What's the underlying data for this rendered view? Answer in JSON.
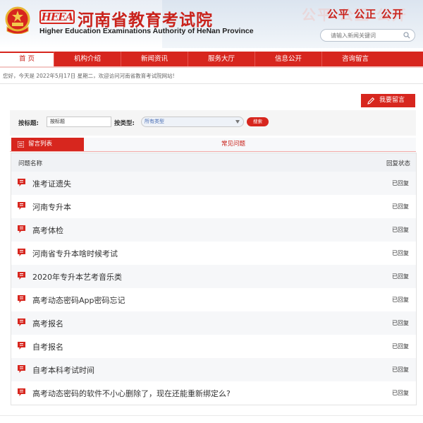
{
  "header": {
    "logo_abbr": "HEEA",
    "title_cn": "河南省教育考试院",
    "title_en": "Higher Education Examinations Authority of HeNan Province",
    "slogan": "公平 公正 公开",
    "search_placeholder": "请输入新闻关键词",
    "colors": {
      "brand_red": "#d7261e"
    }
  },
  "nav": {
    "items": [
      {
        "label": "首 页",
        "active": true
      },
      {
        "label": "机构介绍"
      },
      {
        "label": "新闻资讯"
      },
      {
        "label": "服务大厅"
      },
      {
        "label": "信息公开"
      },
      {
        "label": "咨询留言"
      }
    ]
  },
  "welcome": "您好，今天是 2022年5月17日 星期二，欢迎访问河南省教育考试院网站!",
  "actions": {
    "my_message": "我要留言"
  },
  "form": {
    "title_label": "按标题:",
    "title_value": "按标题",
    "type_label": "按类型:",
    "type_selected": "所有类型",
    "search_button": "搜索"
  },
  "tabs": {
    "active": "留言列表",
    "other": "常见问题"
  },
  "table": {
    "col_name": "问题名称",
    "col_status": "回复状态",
    "rows": [
      {
        "title": "准考证遗失",
        "status": "已回复"
      },
      {
        "title": "河南专升本",
        "status": "已回复"
      },
      {
        "title": "高考体检",
        "status": "已回复"
      },
      {
        "title": "河南省专升本啥时候考试",
        "status": "已回复"
      },
      {
        "title": "2020年专升本艺考音乐类",
        "status": "已回复"
      },
      {
        "title": "高考动态密码App密码忘记",
        "status": "已回复"
      },
      {
        "title": "高考报名",
        "status": "已回复"
      },
      {
        "title": "自考报名",
        "status": "已回复"
      },
      {
        "title": "自考本科考试时间",
        "status": "已回复"
      },
      {
        "title": "高考动态密码的软件不小心删除了，现在还能重新绑定么?",
        "status": "已回复"
      }
    ]
  }
}
